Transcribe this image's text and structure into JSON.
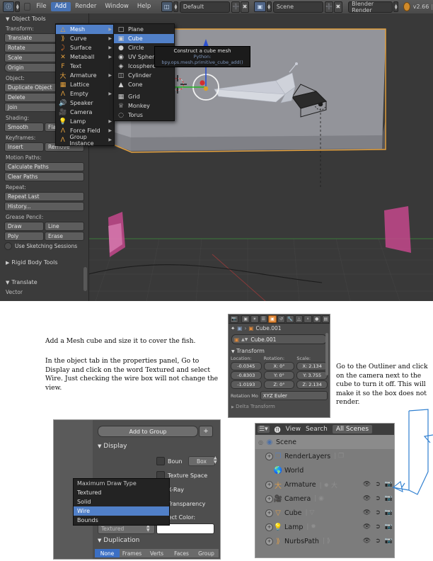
{
  "app": {
    "version_label": "v2.66",
    "top_menus": [
      "File",
      "Add",
      "Render",
      "Window",
      "Help"
    ],
    "active_top_menu": "Add",
    "screen_layout": "Default",
    "scene_name": "Scene",
    "render_engine": "Blender Render"
  },
  "tool_shelf": {
    "panel_title": "Object Tools",
    "transform_label": "Transform:",
    "transform_buttons": [
      "Translate",
      "Rotate",
      "Scale",
      "Origin"
    ],
    "object_label": "Object:",
    "object_buttons": [
      "Duplicate Object",
      "Delete",
      "Join"
    ],
    "shading_label": "Shading:",
    "shading_buttons": [
      "Smooth",
      "Flat"
    ],
    "keyframes_label": "Keyframes:",
    "keyframes_buttons": [
      "Insert",
      "Remove"
    ],
    "motion_paths_label": "Motion Paths:",
    "motion_paths_buttons": [
      "Calculate Paths",
      "Clear Paths"
    ],
    "repeat_label": "Repeat:",
    "repeat_buttons": [
      "Repeat Last",
      "History..."
    ],
    "grease_pencil_label": "Grease Pencil:",
    "grease_pencil_buttons": [
      "Draw",
      "Line",
      "Poly",
      "Erase"
    ],
    "sketching_checkbox": "Use Sketching Sessions",
    "rigid_body_tools": "Rigid Body Tools",
    "translate_panel": "Translate",
    "vector_label": "Vector"
  },
  "add_menu": {
    "items": [
      {
        "label": "Mesh",
        "icon": "mesh-triangle-icon",
        "submenu": true,
        "selected": true
      },
      {
        "label": "Curve",
        "icon": "curve-icon",
        "submenu": true,
        "selected": false
      },
      {
        "label": "Surface",
        "icon": "surface-icon",
        "submenu": true,
        "selected": false
      },
      {
        "label": "Metaball",
        "icon": "metaball-icon",
        "submenu": true,
        "selected": false
      },
      {
        "label": "Text",
        "icon": "text-f-icon",
        "submenu": false,
        "selected": false
      },
      {
        "label": "Armature",
        "icon": "armature-icon",
        "submenu": true,
        "selected": false
      },
      {
        "label": "Lattice",
        "icon": "lattice-icon",
        "submenu": false,
        "selected": false
      },
      {
        "label": "Empty",
        "icon": "empty-axis-icon",
        "submenu": true,
        "selected": false
      },
      {
        "label": "Speaker",
        "icon": "speaker-icon",
        "submenu": false,
        "selected": false
      },
      {
        "label": "Camera",
        "icon": "camera-icon",
        "submenu": false,
        "selected": false
      },
      {
        "label": "Lamp",
        "icon": "lamp-icon",
        "submenu": true,
        "selected": false
      },
      {
        "label": "Force Field",
        "icon": "force-field-icon",
        "submenu": true,
        "selected": false
      },
      {
        "label": "Group Instance",
        "icon": "group-instance-icon",
        "submenu": true,
        "selected": false
      }
    ]
  },
  "mesh_submenu": {
    "items": [
      {
        "label": "Plane",
        "icon": "plane-icon",
        "selected": false
      },
      {
        "label": "Cube",
        "icon": "cube-icon",
        "selected": true
      },
      {
        "label": "Circle",
        "icon": "circle-icon",
        "selected": false
      },
      {
        "label": "UV Sphere",
        "icon": "uvsphere-icon",
        "selected": false
      },
      {
        "label": "Icosphere",
        "icon": "icosphere-icon",
        "selected": false
      },
      {
        "label": "Cylinder",
        "icon": "cylinder-icon",
        "selected": false
      },
      {
        "label": "Cone",
        "icon": "cone-icon",
        "selected": false
      },
      {
        "label": "Grid",
        "icon": "grid-icon",
        "selected": false
      },
      {
        "label": "Monkey",
        "icon": "monkey-icon",
        "selected": false
      },
      {
        "label": "Torus",
        "icon": "torus-icon",
        "selected": false
      }
    ]
  },
  "tooltip": {
    "title": "Construct a cube mesh",
    "python": "Python: bpy.ops.mesh.primitive_cube_add()"
  },
  "notes": {
    "center": [
      "Add a Mesh cube and size it to cover the fish.",
      "In the object tab in the properties panel, Go to Display and click on the word Textured and select Wire. Just checking the wire box will not change the view."
    ],
    "right": "Go to the Outliner and click on the camera next to the cube to turn it off. This will make it so the box does not render."
  },
  "properties_panel": {
    "breadcrumb_object": "Cube.001",
    "object_name_field": "Cube.001",
    "transform_header": "Transform",
    "column_headers": [
      "Location:",
      "Rotation:",
      "Scale:"
    ],
    "location": [
      "-0.0345",
      "-0.8303",
      "-1.0193"
    ],
    "rotation": [
      "X: 0°",
      "Y: 0°",
      "Z: 0°"
    ],
    "scale": [
      "X: 2.134",
      "Y: 3.755",
      "Z: 2.134"
    ],
    "rotation_mode_label": "Rotation Mo",
    "rotation_mode_value": "XYZ Euler",
    "delta_transform": "Delta Transform"
  },
  "display_panel": {
    "add_to_group": "Add to Group",
    "add_to_group_plus": "+",
    "display_header": "Display",
    "checkboxes": [
      "Boun",
      "Texture Space",
      "X-Ray",
      "Transparency"
    ],
    "bounds_type": "Box",
    "object_color_label": "Object Color:",
    "object_color": "#ffffff",
    "draw_type_value": "Textured",
    "duplication_header": "Duplication",
    "duplication_tabs": [
      "None",
      "Frames",
      "Verts",
      "Faces",
      "Group"
    ],
    "dropdown": {
      "header": "Maximum Draw Type",
      "items": [
        "Textured",
        "Solid",
        "Wire",
        "Bounds"
      ],
      "selected": "Wire"
    }
  },
  "outliner": {
    "header_items": [
      "View",
      "Search"
    ],
    "display_mode": "All Scenes",
    "rows": [
      {
        "name": "Scene",
        "icon": "scene-icon",
        "indent": 0,
        "expandable": true,
        "has_toggles": false
      },
      {
        "name": "RenderLayers",
        "icon": "renderlayers-icon",
        "indent": 1,
        "expandable": true,
        "has_toggles": false
      },
      {
        "name": "World",
        "icon": "world-icon",
        "indent": 1,
        "expandable": false,
        "has_toggles": false
      },
      {
        "name": "Armature",
        "icon": "armature-icon",
        "indent": 1,
        "expandable": true,
        "has_toggles": true,
        "render_off": false
      },
      {
        "name": "Camera",
        "icon": "camera-icon",
        "indent": 1,
        "expandable": true,
        "has_toggles": true,
        "render_off": false
      },
      {
        "name": "Cube",
        "icon": "mesh-icon",
        "indent": 1,
        "expandable": true,
        "has_toggles": true,
        "render_off": true
      },
      {
        "name": "Lamp",
        "icon": "lamp-icon",
        "indent": 1,
        "expandable": true,
        "has_toggles": true,
        "render_off": false
      },
      {
        "name": "NurbsPath",
        "icon": "curve-icon",
        "indent": 1,
        "expandable": true,
        "has_toggles": true,
        "render_off": false
      }
    ],
    "toggle_icons": [
      "eye-icon",
      "cursor-arrow-icon",
      "camera-render-icon"
    ]
  },
  "colors": {
    "selection_blue": "#5180c8",
    "selected_object_orange": "#e8a33d",
    "annotation_arrow": "#2f7fd0"
  }
}
